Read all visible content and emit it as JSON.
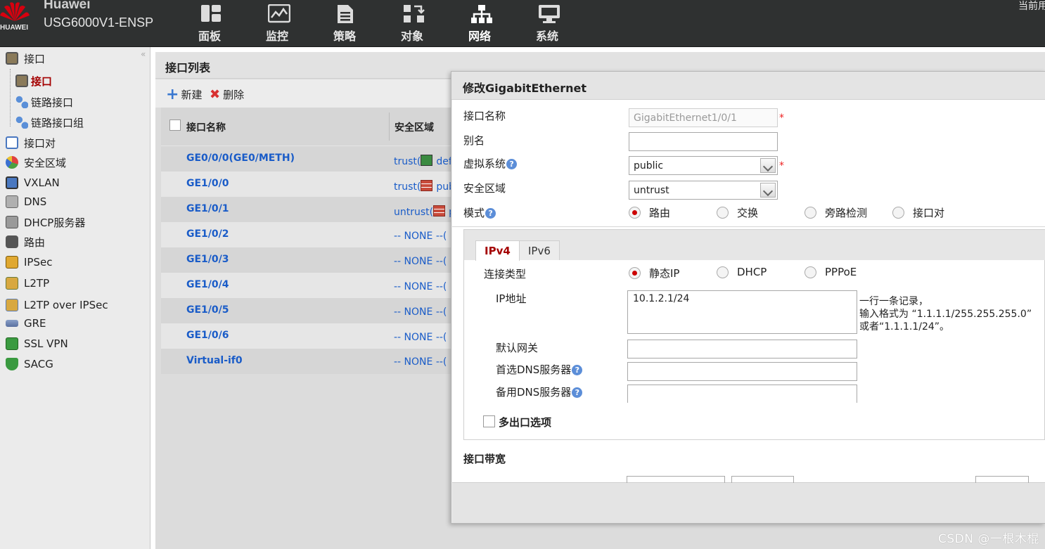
{
  "header": {
    "brand_name": "Huawei",
    "brand_sub": "HUAWEI",
    "model": "USG6000V1-ENSP",
    "current_user_label": "当前用",
    "nav": [
      {
        "label": "面板",
        "icon": "dashboard-icon"
      },
      {
        "label": "监控",
        "icon": "monitor-icon"
      },
      {
        "label": "策略",
        "icon": "policy-icon"
      },
      {
        "label": "对象",
        "icon": "object-icon"
      },
      {
        "label": "网络",
        "icon": "network-icon"
      },
      {
        "label": "系统",
        "icon": "system-icon"
      }
    ],
    "active_nav": "网络"
  },
  "sidebar": {
    "items": [
      {
        "label": "接口",
        "level": 0
      },
      {
        "label": "接口",
        "level": 1,
        "active": true
      },
      {
        "label": "链路接口",
        "level": 1
      },
      {
        "label": "链路接口组",
        "level": 1
      },
      {
        "label": "接口对",
        "level": 0
      },
      {
        "label": "安全区域",
        "level": 0
      },
      {
        "label": "VXLAN",
        "level": 0
      },
      {
        "label": "DNS",
        "level": 0
      },
      {
        "label": "DHCP服务器",
        "level": 0
      },
      {
        "label": "路由",
        "level": 0
      },
      {
        "label": "IPSec",
        "level": 0
      },
      {
        "label": "L2TP",
        "level": 0
      },
      {
        "label": "L2TP over IPSec",
        "level": 0
      },
      {
        "label": "GRE",
        "level": 0
      },
      {
        "label": "SSL VPN",
        "level": 0
      },
      {
        "label": "SACG",
        "level": 0
      }
    ]
  },
  "main": {
    "title": "接口列表",
    "toolbar": {
      "new_label": "新建",
      "delete_label": "删除"
    },
    "table": {
      "headers": [
        "接口名称",
        "安全区域"
      ],
      "rows": [
        {
          "name": "GE0/0/0(GE0/METH)",
          "zone": "trust(",
          "zone_tail": "defa"
        },
        {
          "name": "GE1/0/0",
          "zone": "trust(",
          "zone_tail": "pub"
        },
        {
          "name": "GE1/0/1",
          "zone": "untrust(",
          "zone_tail": "p"
        },
        {
          "name": "GE1/0/2",
          "zone": "-- NONE --(",
          "zone_tail": ""
        },
        {
          "name": "GE1/0/3",
          "zone": "-- NONE --(",
          "zone_tail": ""
        },
        {
          "name": "GE1/0/4",
          "zone": "-- NONE --(",
          "zone_tail": ""
        },
        {
          "name": "GE1/0/5",
          "zone": "-- NONE --(",
          "zone_tail": ""
        },
        {
          "name": "GE1/0/6",
          "zone": "-- NONE --(",
          "zone_tail": ""
        },
        {
          "name": "Virtual-if0",
          "zone": "-- NONE --(",
          "zone_tail": ""
        }
      ]
    }
  },
  "dialog": {
    "title": "修改GigabitEthernet",
    "fields": {
      "interface_name_label": "接口名称",
      "interface_name_value": "GigabitEthernet1/0/1",
      "alias_label": "别名",
      "alias_value": "",
      "vsys_label": "虚拟系统",
      "vsys_value": "public",
      "zone_label": "安全区域",
      "zone_value": "untrust",
      "mode_label": "模式",
      "mode_options": [
        "路由",
        "交换",
        "旁路检测",
        "接口对"
      ],
      "mode_selected": "路由",
      "required_mark": "*",
      "help_mark": "?"
    },
    "tabs": [
      "IPv4",
      "IPv6"
    ],
    "active_tab": "IPv4",
    "ipv4": {
      "conn_type_label": "连接类型",
      "conn_options": [
        "静态IP",
        "DHCP",
        "PPPoE"
      ],
      "conn_selected": "静态IP",
      "ip_label": "IP地址",
      "ip_value": "10.1.2.1/24",
      "hint_line1": "一行一条记录，",
      "hint_line2": "输入格式为 “1.1.1.1/255.255.255.0”",
      "hint_line3": "或者“1.1.1.1/24”。",
      "gateway_label": "默认网关",
      "dns1_label": "首选DNS服务器",
      "dns2_label": "备用DNS服务器",
      "multi_exit_label": "多出口选项"
    },
    "bandwidth_title": "接口带宽"
  },
  "watermark": "CSDN @一根木棍",
  "colors": {
    "accent_red": "#a40000",
    "link_blue": "#1a5cc8",
    "header_bg": "#2f3131"
  }
}
